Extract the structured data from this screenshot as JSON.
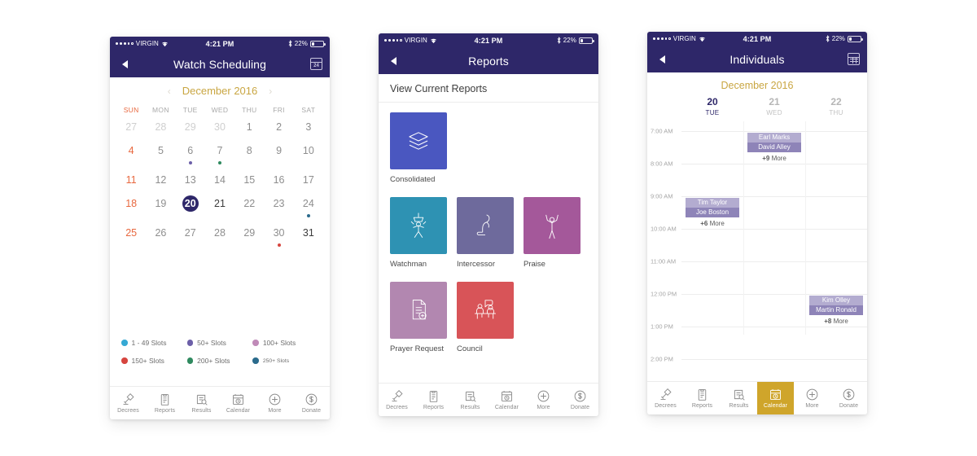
{
  "colors": {
    "header": "#2e2769",
    "gold": "#c9a642",
    "active_tab": "#cfa52b",
    "sunday": "#e8683f",
    "event_light": "#b3acd0",
    "event_dark": "#8e84b8"
  },
  "status_bar": {
    "carrier": "VIRGIN",
    "time": "4:21 PM",
    "battery_percent": "22%"
  },
  "tabs": [
    {
      "label": "Decrees",
      "icon": "gavel-icon"
    },
    {
      "label": "Reports",
      "icon": "clipboard-icon"
    },
    {
      "label": "Results",
      "icon": "document-search-icon"
    },
    {
      "label": "Calendar",
      "icon": "calendar-clock-icon"
    },
    {
      "label": "More",
      "icon": "plus-circle-icon"
    },
    {
      "label": "Donate",
      "icon": "dollar-circle-icon"
    }
  ],
  "phone1": {
    "title": "Watch Scheduling",
    "header_icon": "calendar-date-icon",
    "header_icon_text": "24",
    "month": "December 2016",
    "prev_arrow": "‹",
    "next_arrow": "›",
    "weekdays": [
      "SUN",
      "MON",
      "TUE",
      "WED",
      "THU",
      "FRI",
      "SAT"
    ],
    "weeks": [
      [
        {
          "n": "27",
          "style": "muted"
        },
        {
          "n": "28",
          "style": "muted"
        },
        {
          "n": "29",
          "style": "muted"
        },
        {
          "n": "30",
          "style": "muted"
        },
        {
          "n": "1",
          "style": "normal"
        },
        {
          "n": "2",
          "style": "normal"
        },
        {
          "n": "3",
          "style": "normal"
        }
      ],
      [
        {
          "n": "4",
          "style": "sunday"
        },
        {
          "n": "5",
          "style": "normal"
        },
        {
          "n": "6",
          "style": "normal",
          "dot": "#6c5fa8"
        },
        {
          "n": "7",
          "style": "normal",
          "dot": "#2f8a5f"
        },
        {
          "n": "8",
          "style": "normal"
        },
        {
          "n": "9",
          "style": "normal"
        },
        {
          "n": "10",
          "style": "normal"
        }
      ],
      [
        {
          "n": "11",
          "style": "sunday"
        },
        {
          "n": "12",
          "style": "normal"
        },
        {
          "n": "13",
          "style": "normal"
        },
        {
          "n": "14",
          "style": "normal"
        },
        {
          "n": "15",
          "style": "normal"
        },
        {
          "n": "16",
          "style": "normal"
        },
        {
          "n": "17",
          "style": "normal"
        }
      ],
      [
        {
          "n": "18",
          "style": "sunday"
        },
        {
          "n": "19",
          "style": "normal"
        },
        {
          "n": "20",
          "style": "selected"
        },
        {
          "n": "21",
          "style": "dark"
        },
        {
          "n": "22",
          "style": "normal"
        },
        {
          "n": "23",
          "style": "normal"
        },
        {
          "n": "24",
          "style": "normal",
          "dot": "#2b6b8c"
        }
      ],
      [
        {
          "n": "25",
          "style": "sunday"
        },
        {
          "n": "26",
          "style": "normal"
        },
        {
          "n": "27",
          "style": "normal"
        },
        {
          "n": "28",
          "style": "normal"
        },
        {
          "n": "29",
          "style": "normal"
        },
        {
          "n": "30",
          "style": "normal",
          "dot": "#d6453f"
        },
        {
          "n": "31",
          "style": "dark"
        }
      ]
    ],
    "legend": [
      {
        "label": "1 - 49 Slots",
        "color": "#36a9d4"
      },
      {
        "label": "50+ Slots",
        "color": "#6c5fa8"
      },
      {
        "label": "100+ Slots",
        "color": "#c08ab8"
      },
      {
        "label": "150+ Slots",
        "color": "#d6453f"
      },
      {
        "label": "200+ Slots",
        "color": "#2f8a5f"
      },
      {
        "label": "250+ Slots",
        "color": "#2b6b8c",
        "small": true
      }
    ],
    "active_tab": ""
  },
  "phone2": {
    "title": "Reports",
    "section_title": "View Current Reports",
    "tiles": [
      [
        {
          "label": "Consolidated",
          "color": "#4a57c0",
          "icon": "layers-icon"
        }
      ],
      [
        {
          "label": "Watchman",
          "color": "#2e92b3",
          "icon": "watchtower-figure-icon"
        },
        {
          "label": "Intercessor",
          "color": "#6e6a9c",
          "icon": "kneeling-figure-icon"
        },
        {
          "label": "Praise",
          "color": "#a4589a",
          "icon": "raised-arms-figure-icon"
        }
      ],
      [
        {
          "label": "Prayer Request",
          "color": "#b287b0",
          "icon": "document-plus-icon"
        },
        {
          "label": "Council",
          "color": "#d85458",
          "icon": "council-meeting-icon"
        }
      ]
    ],
    "active_tab": ""
  },
  "phone3": {
    "title": "Individuals",
    "header_icon": "calendar-grid-icon",
    "month": "December 2016",
    "days": [
      {
        "num": "20",
        "name": "TUE",
        "selected": true
      },
      {
        "num": "21",
        "name": "WED",
        "selected": false
      },
      {
        "num": "22",
        "name": "THU",
        "selected": false
      }
    ],
    "hours": [
      "7:00 AM",
      "8:00 AM",
      "9:00 AM",
      "10:00 AM",
      "11:00 AM",
      "12:00 PM",
      "1:00 PM",
      "2:00 PM"
    ],
    "events": [
      {
        "name1": "Earl Marks",
        "name2": "David Alley",
        "more_count": "+9",
        "more_label": "More",
        "col": 1,
        "hour_index": 0
      },
      {
        "name1": "Tim Taylor",
        "name2": "Joe Boston",
        "more_count": "+6",
        "more_label": "More",
        "col": 0,
        "hour_index": 2
      },
      {
        "name1": "Kim Olley",
        "name2": "Martin Ronald",
        "more_count": "+8",
        "more_label": "More",
        "col": 2,
        "hour_index": 5
      }
    ],
    "active_tab": "Calendar"
  }
}
